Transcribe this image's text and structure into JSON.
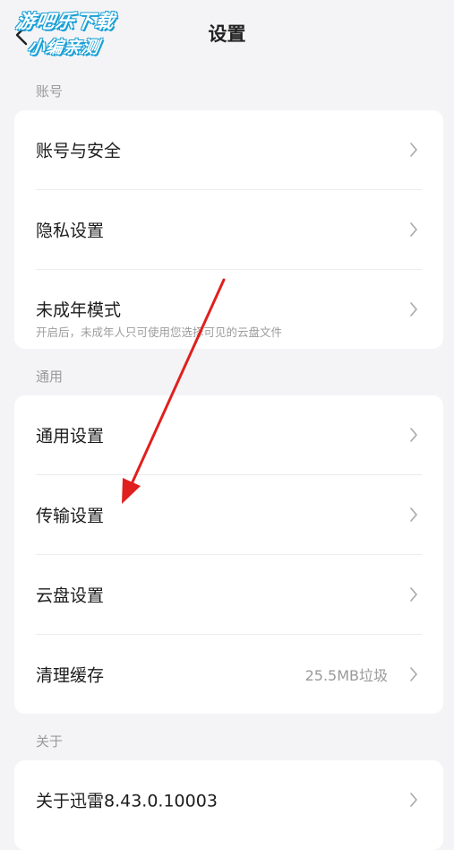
{
  "header": {
    "title": "设置",
    "back_icon": "back-arrow-icon",
    "watermark": {
      "line1": "游吧乐下载",
      "line2": "小编亲测"
    }
  },
  "sections": [
    {
      "label": "账号",
      "items": [
        {
          "label": "账号与安全"
        },
        {
          "label": "隐私设置"
        },
        {
          "label": "未成年模式",
          "subtitle": "开启后，未成年人只可使用您选择可见的云盘文件"
        }
      ]
    },
    {
      "label": "通用",
      "items": [
        {
          "label": "通用设置"
        },
        {
          "label": "传输设置"
        },
        {
          "label": "云盘设置"
        },
        {
          "label": "清理缓存",
          "value": "25.5MB垃圾"
        }
      ]
    },
    {
      "label": "关于",
      "items": [
        {
          "label": "关于迅雷8.43.0.10003"
        }
      ]
    }
  ],
  "annotation": {
    "arrow_color": "#e0201e"
  },
  "icons": {
    "chevron": "chevron-right-icon"
  }
}
